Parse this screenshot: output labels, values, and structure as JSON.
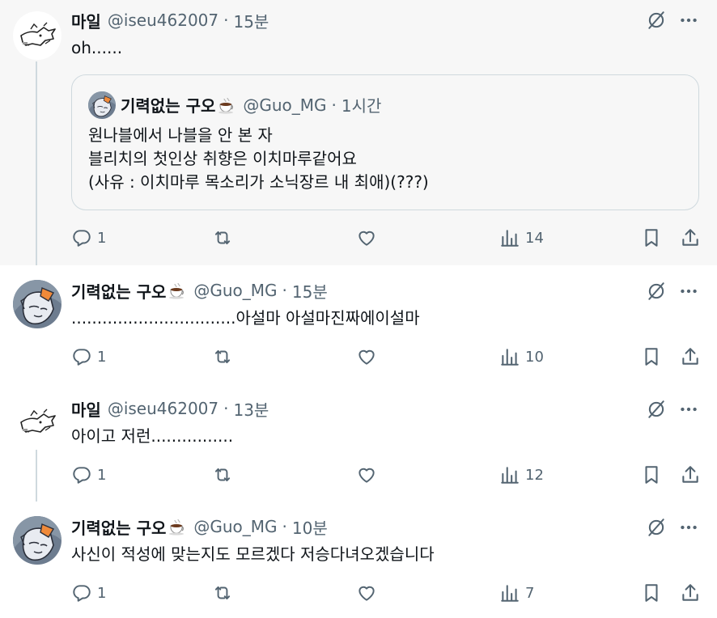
{
  "tweets": [
    {
      "name": "마일",
      "handle": "@iseu462007",
      "separator": "·",
      "time": "15분",
      "text": "oh......",
      "quote": {
        "name": "기력없는 구오",
        "handle": "@Guo_MG",
        "separator": "·",
        "time": "1시간",
        "lines": [
          "원나블에서 나블을 안 본 자",
          "블리치의 첫인상 취향은 이치마루같어요",
          "(사유 : 이치마루 목소리가 소닉장르 내 최애)(???)"
        ]
      },
      "replies": "1",
      "views": "14"
    },
    {
      "name": "기력없는 구오",
      "handle": "@Guo_MG",
      "separator": "·",
      "time": "15분",
      "text": "................................아설마 아설마진짜에이설마",
      "replies": "1",
      "views": "10"
    },
    {
      "name": "마일",
      "handle": "@iseu462007",
      "separator": "·",
      "time": "13분",
      "text": "아이고 저런................",
      "replies": "1",
      "views": "12"
    },
    {
      "name": "기력없는 구오",
      "handle": "@Guo_MG",
      "separator": "·",
      "time": "10분",
      "text": "사신이 적성에 맞는지도 모르겠다 저승다녀오겠습니다",
      "replies": "1",
      "views": "7"
    }
  ],
  "icons": {
    "reply": "reply-icon",
    "retweet": "retweet-icon",
    "like": "heart-icon",
    "views": "views-icon",
    "bookmark": "bookmark-icon",
    "share": "share-icon",
    "grok": "grok-icon",
    "more": "more-icon",
    "emoji": "coffee-emoji"
  },
  "colors": {
    "text": "#0f1419",
    "secondary": "#536471",
    "border": "#cfd9de",
    "highlight_bg": "#f7f7f7"
  }
}
